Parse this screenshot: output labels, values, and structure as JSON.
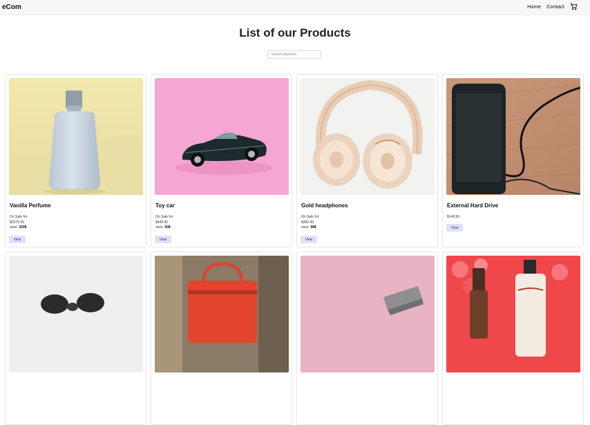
{
  "nav": {
    "brand": "eCom",
    "links": [
      "Home",
      "Contact"
    ],
    "cart_icon": "cart-icon"
  },
  "page": {
    "title": "List of our Products",
    "search_placeholder": "Search products"
  },
  "products": [
    {
      "name": "Vanilla Perfume",
      "on_sale_label": "On Sale for:",
      "price": "$2079.99",
      "save_label": "save:",
      "save": "320$",
      "button": "View"
    },
    {
      "name": "Toy car",
      "on_sale_label": "On Sale for:",
      "price": "$449.95",
      "save_label": "save:",
      "save": "50$",
      "button": "View"
    },
    {
      "name": "Gold headphones",
      "on_sale_label": "On Sale for:",
      "price": "$382.49",
      "save_label": "save:",
      "save": "68$",
      "button": "View"
    },
    {
      "name": "External Hard Drive",
      "price": "$149.99",
      "button": "View"
    }
  ],
  "colors": {
    "accent_button": "#dfe1fb",
    "navbar_bg": "#f7f7f7"
  }
}
